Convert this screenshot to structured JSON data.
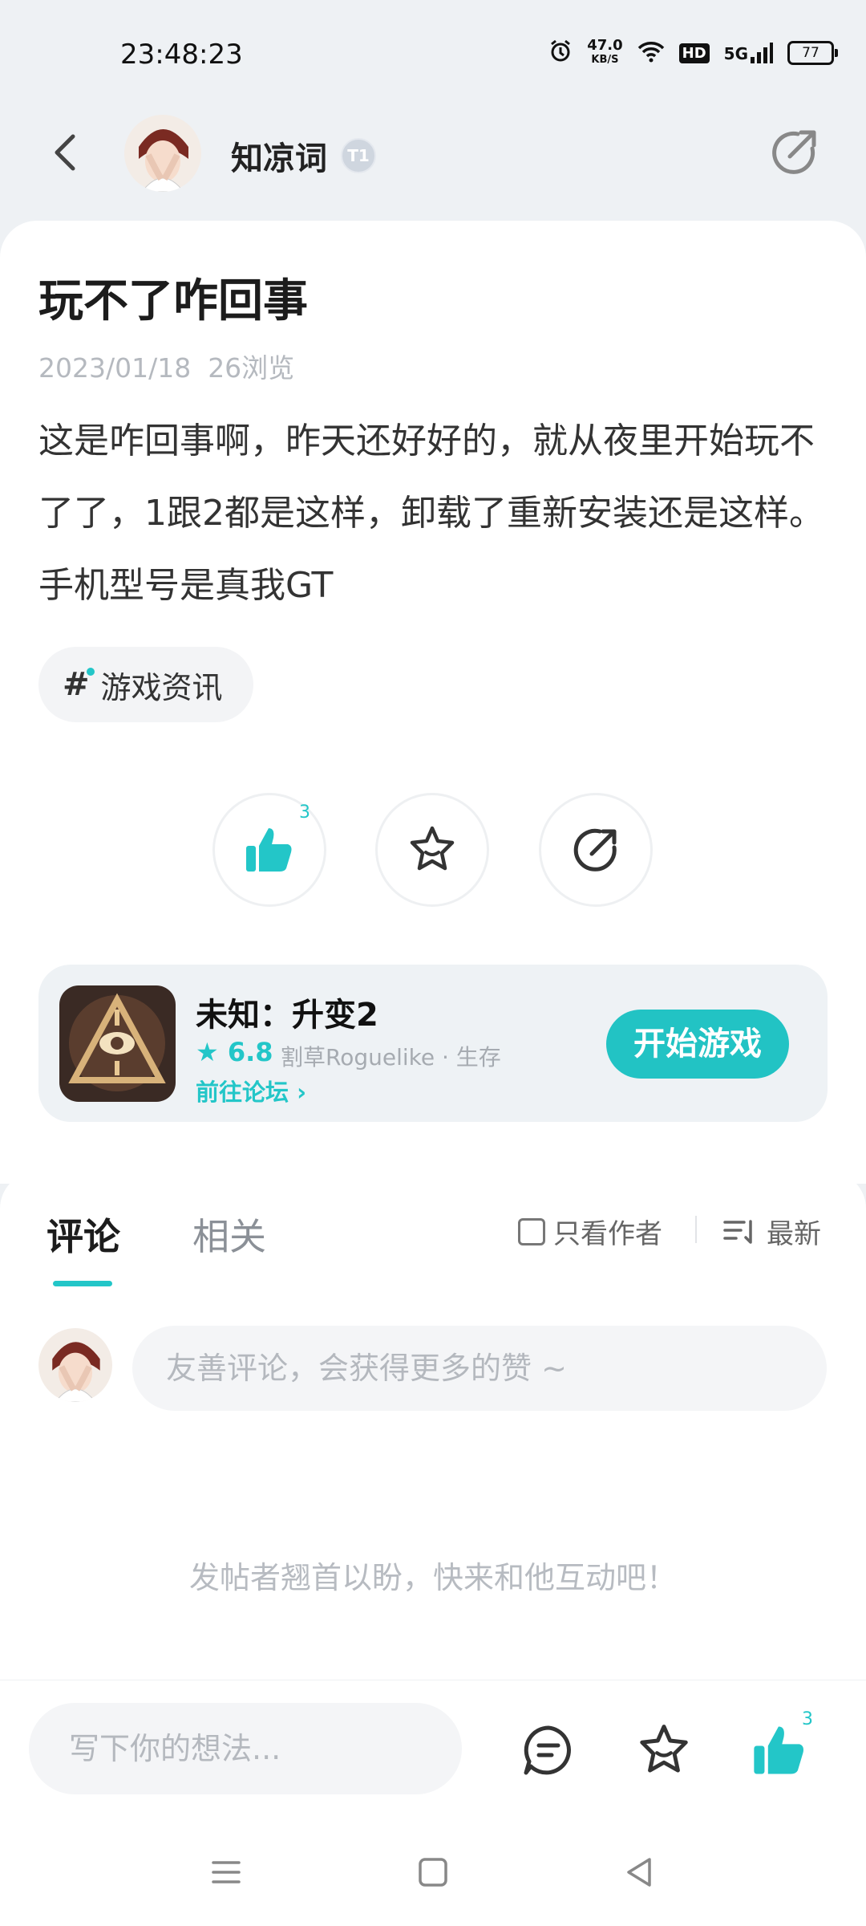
{
  "status_bar": {
    "time": "23:48:23",
    "net_speed_value": "47.0",
    "net_speed_unit": "KB/S",
    "hd": "HD",
    "signal": "5G",
    "battery": "77",
    "icons": [
      "alarm-icon",
      "wifi-icon",
      "hd-icon",
      "signal-icon",
      "battery-icon"
    ]
  },
  "header": {
    "author_name": "知凉词",
    "badge": "T1",
    "icons": [
      "back-arrow-icon",
      "share-icon"
    ]
  },
  "post": {
    "title": "玩不了咋回事",
    "date": "2023/01/18",
    "views": "26浏览",
    "body": "这是咋回事啊，昨天还好好的，就从夜里开始玩不了了，1跟2都是这样，卸载了重新安装还是这样。手机型号是真我GT",
    "tag": "游戏资讯",
    "like_count": "3"
  },
  "game": {
    "name": "未知：升变2",
    "score": "6.8",
    "genre": "割草Roguelike · 生存",
    "forum_link": "前往论坛",
    "play_button": "开始游戏"
  },
  "comments": {
    "tab_comment": "评论",
    "tab_related": "相关",
    "only_author": "只看作者",
    "sort": "最新",
    "input_placeholder": "友善评论，会获得更多的赞 ~",
    "empty_text": "发帖者翘首以盼，快来和他互动吧！"
  },
  "bottom_bar": {
    "write_placeholder": "写下你的想法...",
    "like_count": "3"
  },
  "colors": {
    "accent": "#23c6c8",
    "background": "#eef1f4"
  }
}
